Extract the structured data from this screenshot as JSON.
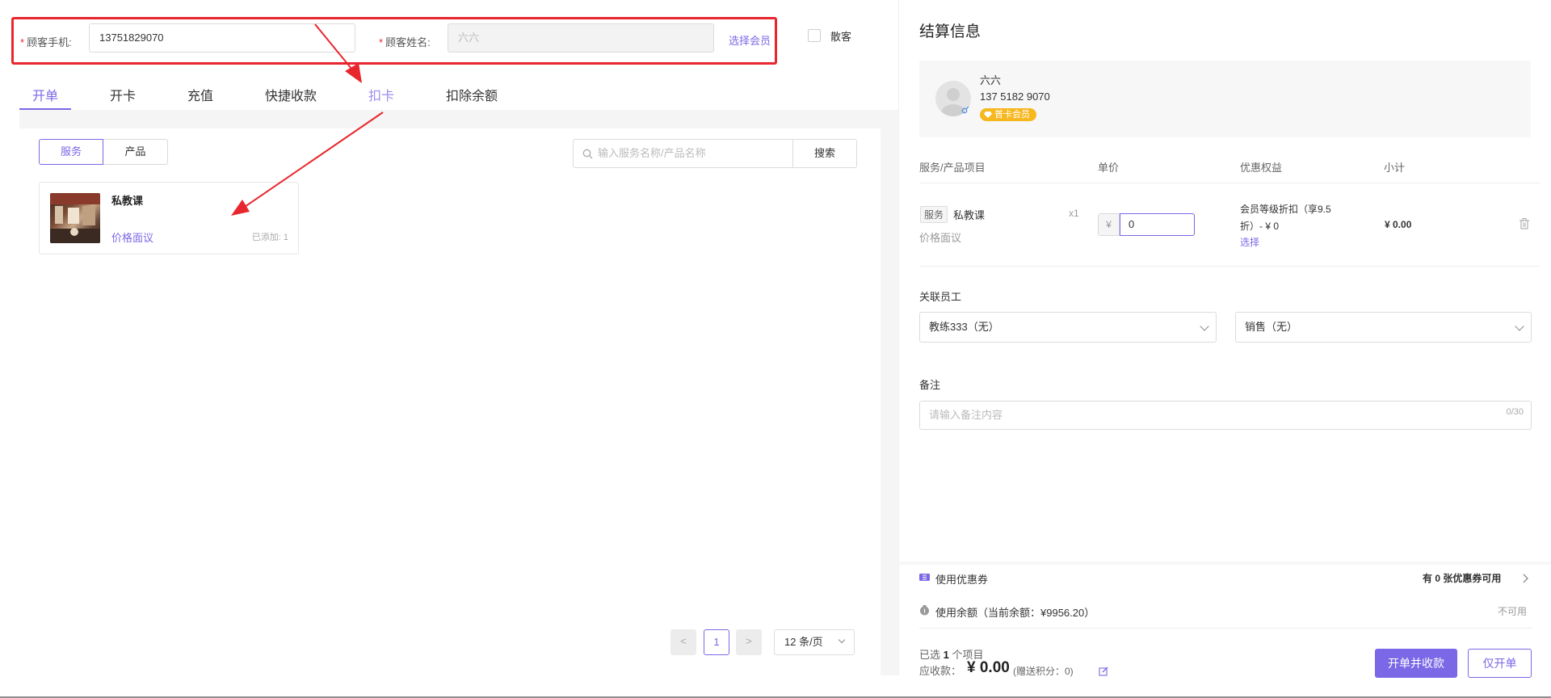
{
  "customer": {
    "phone_label": "顾客手机:",
    "phone_value": "13751829070",
    "name_label": "顾客姓名:",
    "name_value": "六六",
    "select_member_link": "选择会员",
    "walkin_label": "散客"
  },
  "tabs": [
    {
      "label": "开单",
      "active": true
    },
    {
      "label": "开卡",
      "active": false
    },
    {
      "label": "充值",
      "active": false
    },
    {
      "label": "快捷收款",
      "active": false
    },
    {
      "label": "扣卡",
      "active": false
    },
    {
      "label": "扣除余额",
      "active": false
    }
  ],
  "catalog": {
    "segments": [
      "服务",
      "产品"
    ],
    "active_segment": "服务",
    "search_placeholder": "输入服务名称/产品名称",
    "search_button": "搜索",
    "items": [
      {
        "name": "私教课",
        "price_label": "价格面议",
        "added": "已添加: 1"
      }
    ],
    "pagination": {
      "prev": "<",
      "current": "1",
      "next": ">",
      "page_size": "12 条/页"
    }
  },
  "checkout": {
    "title": "结算信息",
    "member": {
      "name": "六六",
      "phone": "137 5182 9070",
      "level": "普卡会员"
    },
    "table_headers": [
      "服务/产品项目",
      "单价",
      "优惠权益",
      "小计"
    ],
    "line_item": {
      "type_tag": "服务",
      "name": "私教课",
      "price_note": "价格面议",
      "qty": "x1",
      "currency": "¥",
      "unit_price": "0",
      "discount_line1": "会员等级折扣（享9.5",
      "discount_line2": "折）- ¥ 0",
      "discount_select": "选择",
      "subtotal": "¥ 0.00"
    },
    "staff_label": "关联员工",
    "staff_coach": "教练333（无）",
    "staff_sales": "销售（无）",
    "remark_label": "备注",
    "remark_placeholder": "请输入备注内容",
    "remark_count": "0/30",
    "coupon_label": "使用优惠券",
    "coupon_status_prefix": "有 ",
    "coupon_count": "0",
    "coupon_status_suffix": " 张优惠券可用",
    "balance_label": "使用余额（当前余额：¥9956.20）",
    "balance_status": "不可用",
    "selected_prefix": "已选 ",
    "selected_count": "1",
    "selected_suffix": " 个项目",
    "receivable_label": "应收款：",
    "receivable_amount": "¥ 0.00",
    "points_note": "(赠送积分：0)",
    "btn_checkout": "开单并收款",
    "btn_only_open": "仅开单"
  },
  "colors": {
    "accent": "#7a68e6",
    "annotation": "#e8262d",
    "badge": "#f7b71f"
  }
}
